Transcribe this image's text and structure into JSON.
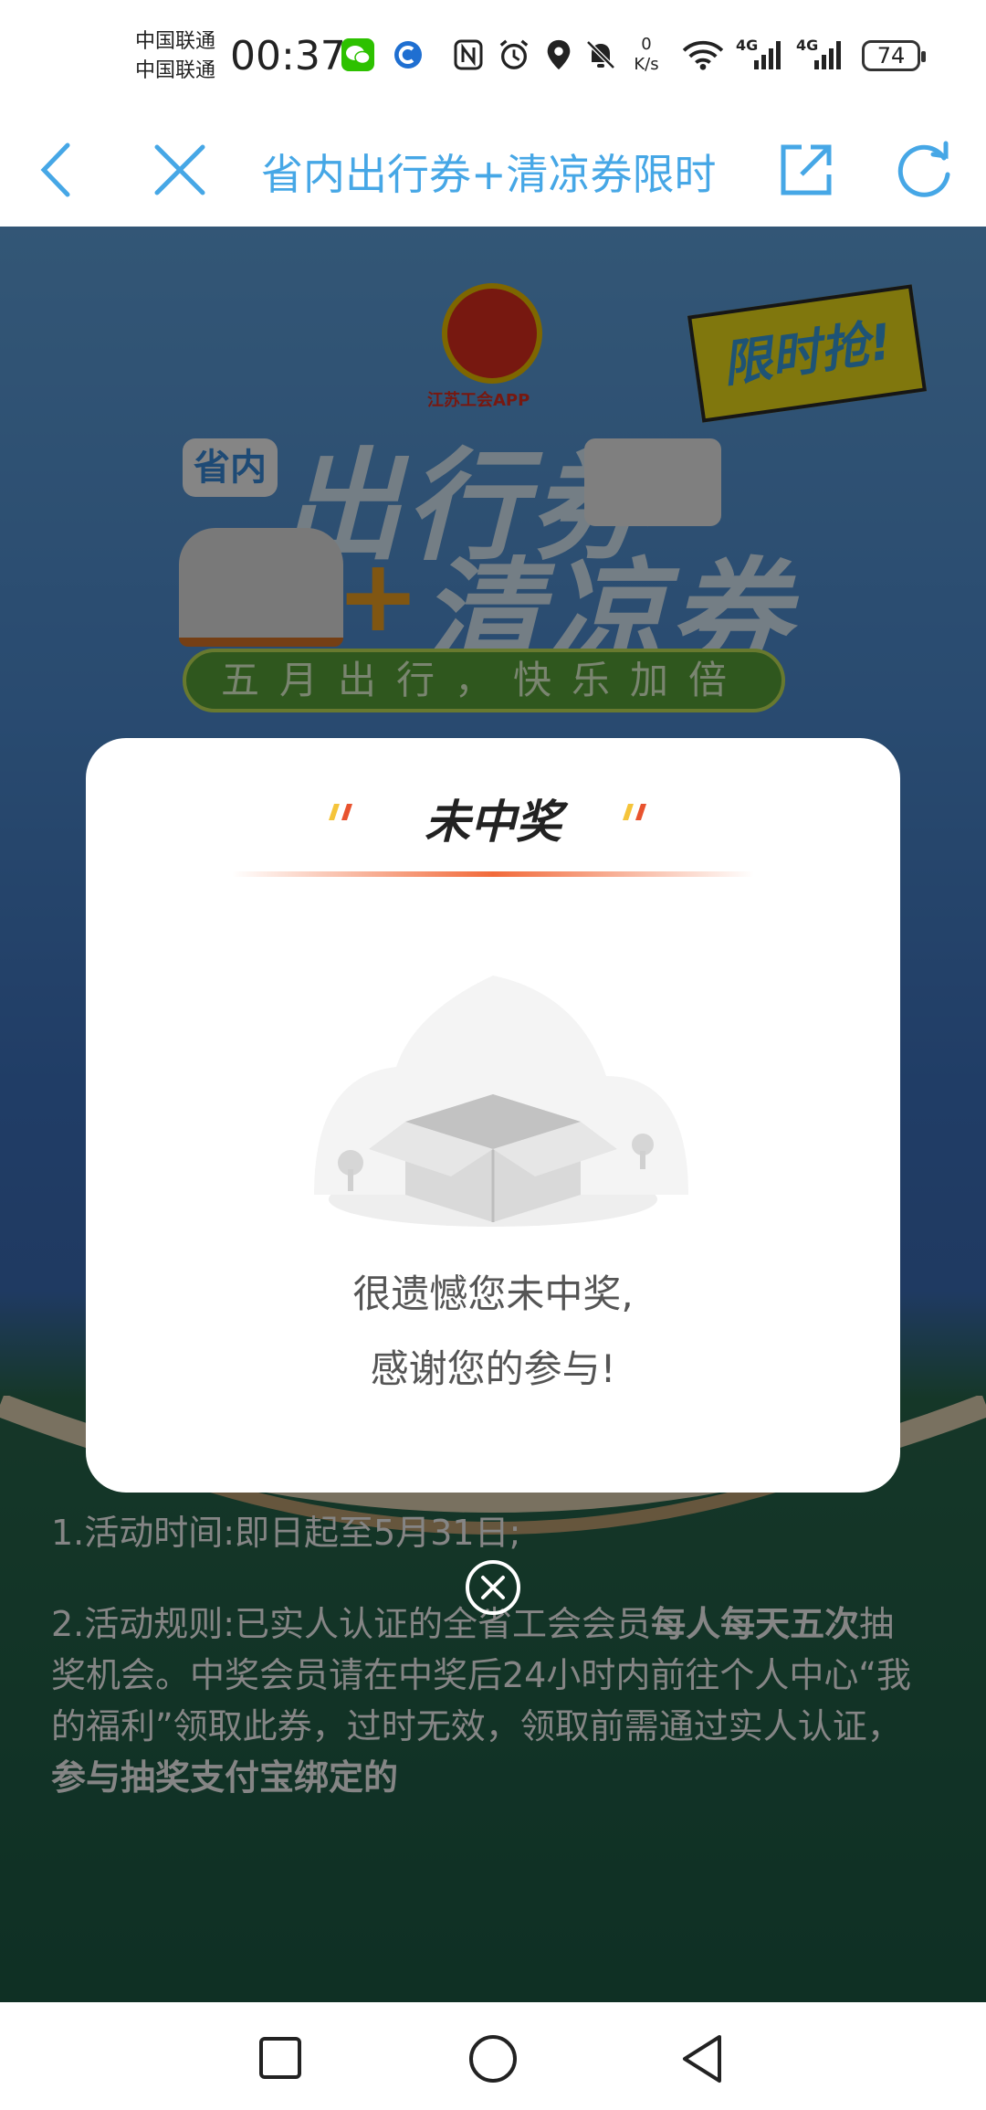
{
  "status_bar": {
    "carrier_1": "中国联通",
    "carrier_2": "中国联通",
    "time": "00:37",
    "net_speed_value": "0",
    "net_speed_unit": "K/s",
    "network_1": "4G",
    "network_2": "4G",
    "battery": "74"
  },
  "nav": {
    "title": "省内出行券+清凉券限时"
  },
  "hero": {
    "logo_caption": "江苏工会APP",
    "badge": "限时抢!",
    "chip": "省内",
    "title_line1": "出行券",
    "plus": "+",
    "title_line2": "清凉券",
    "slogan": "五月出行，快乐加倍"
  },
  "modal": {
    "title": "未中奖",
    "message_line1": "很遗憾您未中奖,",
    "message_line2": "感谢您的参与!"
  },
  "rules": {
    "rule1": "1.活动时间:即日起至5月31日;",
    "rule2_part1": "2.活动规则:已实人认证的全省工会会员",
    "rule2_bold1": "每人每天五次",
    "rule2_part2": "抽奖机会。中奖会员请在中奖后24小时内前往个人中心“我的福利”领取此券，过时无效，领取前需通过实人认证，",
    "rule2_bold2": "参与抽奖支付宝绑定的"
  },
  "colors": {
    "accent": "#46a7e6",
    "modal_line": "#f26a3a"
  }
}
